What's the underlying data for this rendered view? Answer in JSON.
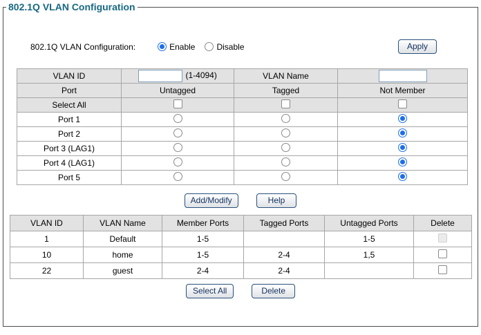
{
  "panel": {
    "legend": "802.1Q VLAN Configuration"
  },
  "config": {
    "label": "802.1Q VLAN Configuration:",
    "selected": "Enable",
    "options": [
      {
        "label": "Enable"
      },
      {
        "label": "Disable"
      }
    ],
    "apply_label": "Apply"
  },
  "vlan_form_table": {
    "vlan_id_label": "VLAN ID",
    "vlan_id_value": "",
    "vlan_id_hint": "(1-4094)",
    "vlan_name_label": "VLAN Name",
    "vlan_name_value": "",
    "columns": {
      "port": "Port",
      "untagged": "Untagged",
      "tagged": "Tagged",
      "not_member": "Not Member"
    },
    "select_all_label": "Select All",
    "rows": [
      {
        "port": "Port 1",
        "membership": "not_member"
      },
      {
        "port": "Port 2",
        "membership": "not_member"
      },
      {
        "port": "Port 3 (LAG1)",
        "membership": "not_member"
      },
      {
        "port": "Port 4 (LAG1)",
        "membership": "not_member"
      },
      {
        "port": "Port 5",
        "membership": "not_member"
      }
    ]
  },
  "form_buttons": {
    "add_modify": "Add/Modify",
    "help": "Help"
  },
  "vlan_list_table": {
    "columns": [
      "VLAN ID",
      "VLAN Name",
      "Member Ports",
      "Tagged Ports",
      "Untagged Ports",
      "Delete"
    ],
    "rows": [
      {
        "vlan_id": "1",
        "vlan_name": "Default",
        "member_ports": "1-5",
        "tagged_ports": "",
        "untagged_ports": "1-5",
        "delete_disabled": true
      },
      {
        "vlan_id": "10",
        "vlan_name": "home",
        "member_ports": "1-5",
        "tagged_ports": "2-4",
        "untagged_ports": "1,5",
        "delete_disabled": false
      },
      {
        "vlan_id": "22",
        "vlan_name": "guest",
        "member_ports": "2-4",
        "tagged_ports": "2-4",
        "untagged_ports": "",
        "delete_disabled": false
      }
    ]
  },
  "list_buttons": {
    "select_all": "Select All",
    "delete": "Delete"
  },
  "colors": {
    "legend_text": "#176882",
    "radio_selected": "#1d6fe8",
    "table_header_bg": "#e2e2e2",
    "table_border": "#a6a6a6",
    "button_border": "#27507c",
    "button_text": "#12305e",
    "panel_border": "#4d4d4d"
  }
}
